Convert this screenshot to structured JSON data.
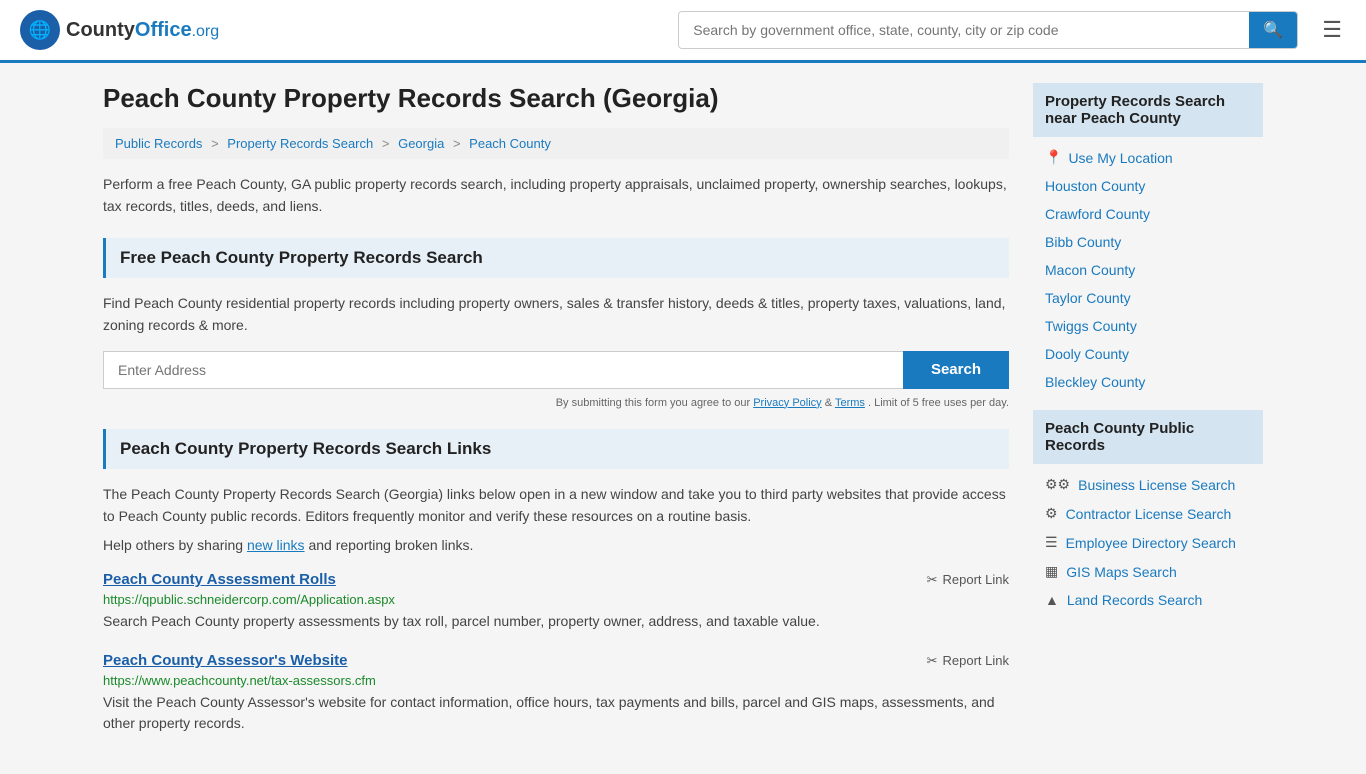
{
  "header": {
    "logo_text": "CountyOffice",
    "logo_ext": ".org",
    "search_placeholder": "Search by government office, state, county, city or zip code"
  },
  "page": {
    "title": "Peach County Property Records Search (Georgia)",
    "breadcrumb": [
      {
        "label": "Public Records",
        "href": "#"
      },
      {
        "label": "Property Records Search",
        "href": "#"
      },
      {
        "label": "Georgia",
        "href": "#"
      },
      {
        "label": "Peach County",
        "href": "#"
      }
    ],
    "intro": "Perform a free Peach County, GA public property records search, including property appraisals, unclaimed property, ownership searches, lookups, tax records, titles, deeds, and liens.",
    "free_search_header": "Free Peach County Property Records Search",
    "free_search_desc": "Find Peach County residential property records including property owners, sales & transfer history, deeds & titles, property taxes, valuations, land, zoning records & more.",
    "address_placeholder": "Enter Address",
    "search_btn_label": "Search",
    "form_disclaimer": "By submitting this form you agree to our",
    "privacy_label": "Privacy Policy",
    "terms_label": "Terms",
    "limit_text": ". Limit of 5 free uses per day.",
    "links_header": "Peach County Property Records Search Links",
    "links_intro": "The Peach County Property Records Search (Georgia) links below open in a new window and take you to third party websites that provide access to Peach County public records. Editors frequently monitor and verify these resources on a routine basis.",
    "new_links_text": "Help others by sharing",
    "new_links_link": "new links",
    "and_text": "and reporting broken links.",
    "records": [
      {
        "title": "Peach County Assessment Rolls",
        "url": "https://qpublic.schneidercorp.com/Application.aspx",
        "desc": "Search Peach County property assessments by tax roll, parcel number, property owner, address, and taxable value.",
        "report_label": "Report Link"
      },
      {
        "title": "Peach County Assessor's Website",
        "url": "https://www.peachcounty.net/tax-assessors.cfm",
        "desc": "Visit the Peach County Assessor's website for contact information, office hours, tax payments and bills, parcel and GIS maps, assessments, and other property records.",
        "report_label": "Report Link"
      }
    ]
  },
  "sidebar": {
    "nearby_header": "Property Records Search near Peach County",
    "use_location_label": "Use My Location",
    "nearby_counties": [
      "Houston County",
      "Crawford County",
      "Bibb County",
      "Macon County",
      "Taylor County",
      "Twiggs County",
      "Dooly County",
      "Bleckley County"
    ],
    "public_records_header": "Peach County Public Records",
    "public_records_links": [
      {
        "icon": "⚙⚙",
        "label": "Business License Search"
      },
      {
        "icon": "⚙",
        "label": "Contractor License Search"
      },
      {
        "icon": "☰",
        "label": "Employee Directory Search"
      },
      {
        "icon": "▦",
        "label": "GIS Maps Search"
      },
      {
        "icon": "▲",
        "label": "Land Records Search"
      }
    ]
  }
}
